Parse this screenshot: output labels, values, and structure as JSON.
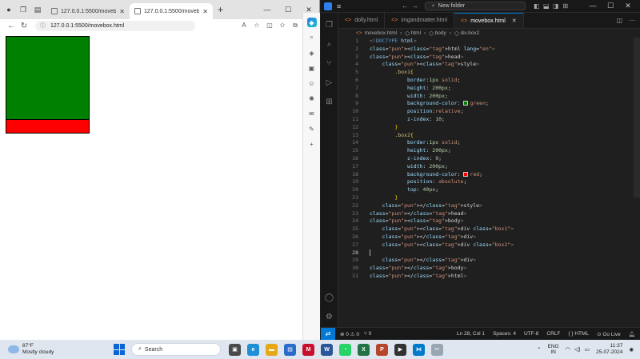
{
  "browser": {
    "tabs": [
      {
        "label": "127.0.0.1:5500/movebox.ht"
      },
      {
        "label": "127.0.0.1:5500/movebox.ht"
      }
    ],
    "url": "127.0.0.1:5500/movebox.html",
    "box1_color": "#008000",
    "box2_color": "#ff0000"
  },
  "vscode": {
    "search": "New folder",
    "tabs": [
      {
        "label": "dolly.html"
      },
      {
        "label": "imgandmatter.html"
      },
      {
        "label": "movebox.html"
      }
    ],
    "breadcrumb": [
      "movebox.html",
      "html",
      "body",
      "div.box2"
    ],
    "lines": [
      "<!DOCTYPE html>",
      "<html lang=\"en\">",
      "<head>",
      "    <style>",
      "        .box1{",
      "            border:1px solid;",
      "            height: 200px;",
      "            width: 200px;",
      "            background-color: green;",
      "            position:relative;",
      "            z-index: 10;",
      "        }",
      "        .box2{",
      "            border:1px solid;",
      "            height: 200px;",
      "            z-index: 9;",
      "            width: 200px;",
      "            background-color: red;",
      "            position: absolute;",
      "            top: 40px;",
      "        }",
      "    </style>",
      "</head>",
      "<body>",
      "    <div class=\"box1\">",
      "    </div>",
      "    <div class=\"box2\">",
      "",
      "    </div>",
      "</body>",
      "</html>"
    ],
    "status": {
      "errors": "0",
      "warnings": "0",
      "ports": "0",
      "position": "Ln 28, Col 1",
      "spaces": "Spaces: 4",
      "encoding": "UTF-8",
      "eol": "CRLF",
      "lang": "HTML",
      "golive": "Go Live"
    }
  },
  "taskbar": {
    "temp": "87°F",
    "weather": "Mostly cloudy",
    "search": "Search",
    "lang1": "ENG",
    "lang2": "IN",
    "time": "11:37",
    "date": "25-07-2024"
  }
}
